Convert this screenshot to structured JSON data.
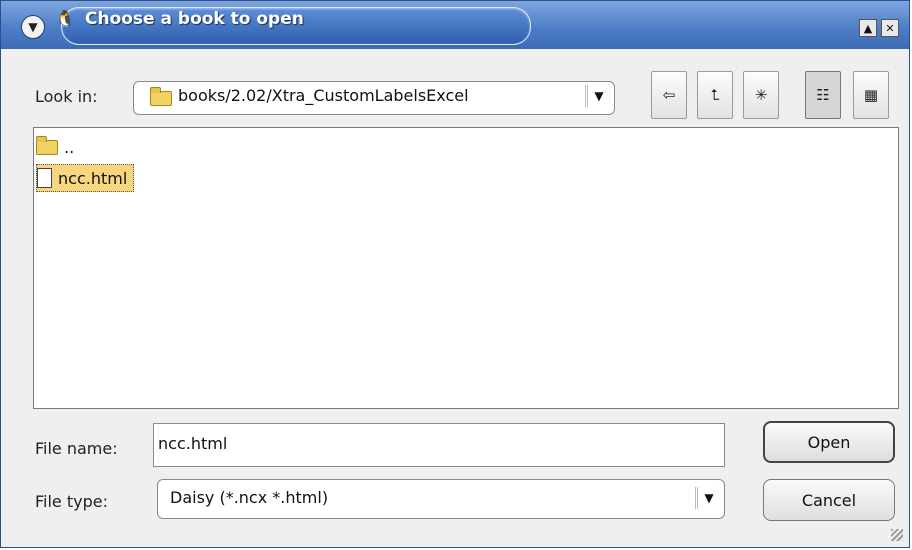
{
  "window": {
    "title": "Choose a book to open"
  },
  "lookin": {
    "label": "Look in:",
    "path": "books/2.02/Xtra_CustomLabelsExcel"
  },
  "files": [
    {
      "name": "..",
      "type": "folder"
    },
    {
      "name": "ncc.html",
      "type": "file",
      "selected": true
    }
  ],
  "filename": {
    "label": "File name:",
    "value": "ncc.html"
  },
  "filetype": {
    "label": "File type:",
    "value": "Daisy (*.ncx *.html)"
  },
  "buttons": {
    "open": "Open",
    "cancel": "Cancel"
  }
}
